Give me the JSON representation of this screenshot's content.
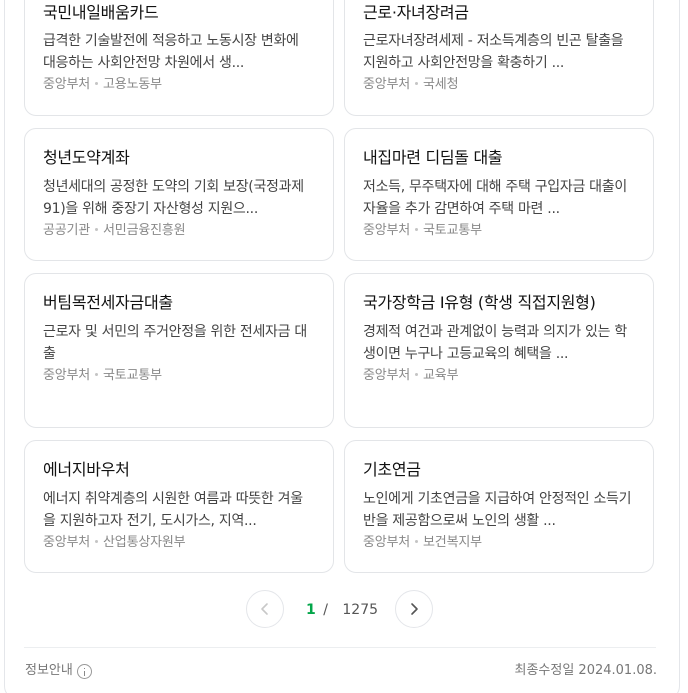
{
  "cards": [
    {
      "title": "국민내일배움카드",
      "desc": "급격한 기술발전에 적응하고 노동시장 변화에 대응하는 사회안전망 차원에서 생...",
      "type": "중앙부처",
      "org": "고용노동부"
    },
    {
      "title": "근로·자녀장려금",
      "desc": "근로자녀장려세제 - 저소득계층의 빈곤 탈출을 지원하고 사회안전망을 확충하기 ...",
      "type": "중앙부처",
      "org": "국세청"
    },
    {
      "title": "청년도약계좌",
      "desc": "청년세대의 공정한 도약의 기회 보장(국정과제91)을 위해 중장기 자산형성 지원으...",
      "type": "공공기관",
      "org": "서민금융진흥원"
    },
    {
      "title": "내집마련 디딤돌 대출",
      "desc": "저소득, 무주택자에 대해 주택 구입자금 대출이자율을 추가 감면하여 주택 마련 ...",
      "type": "중앙부처",
      "org": "국토교통부"
    },
    {
      "title": "버팀목전세자금대출",
      "desc": "근로자 및 서민의 주거안정을 위한 전세자금 대출",
      "type": "중앙부처",
      "org": "국토교통부"
    },
    {
      "title": "국가장학금 Ⅰ유형 (학생 직접지원형)",
      "desc": "경제적 여건과 관계없이 능력과 의지가 있는 학생이면 누구나 고등교육의 혜택을 ...",
      "type": "중앙부처",
      "org": "교육부"
    },
    {
      "title": "에너지바우처",
      "desc": "에너지 취약계층의 시원한 여름과 따뜻한 겨울을 지원하고자 전기, 도시가스, 지역...",
      "type": "중앙부처",
      "org": "산업통상자원부"
    },
    {
      "title": "기초연금",
      "desc": "노인에게 기초연금을 지급하여 안정적인 소득기반을 제공함으로써 노인의 생활 ...",
      "type": "중앙부처",
      "org": "보건복지부"
    }
  ],
  "pagination": {
    "current": "1",
    "separator": "/",
    "total": "1275"
  },
  "footer": {
    "info_label": "정보안내",
    "updated": "최종수정일 2024.01.08."
  },
  "colors": {
    "accent": "#03a64a",
    "border": "#e3e5e8"
  },
  "icons": {
    "prev": "chevron-left-icon",
    "next": "chevron-right-icon",
    "info": "info-icon"
  }
}
